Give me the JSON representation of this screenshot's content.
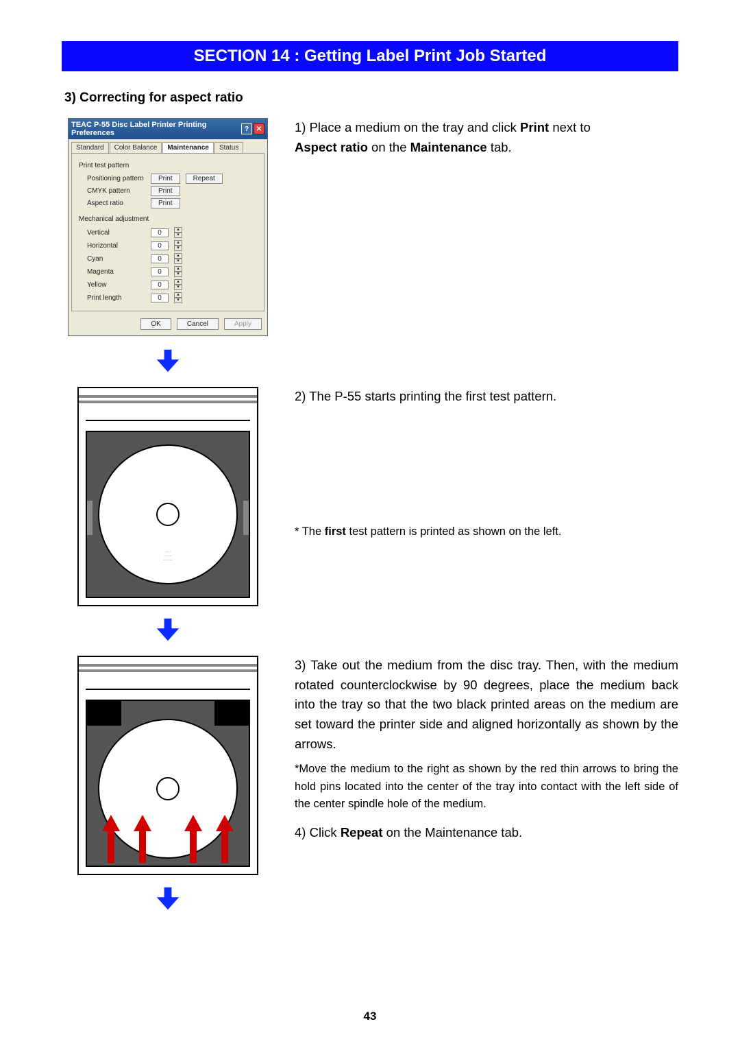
{
  "section_title": "SECTION 14 : Getting Label Print Job Started",
  "subheading": "3) Correcting for aspect ratio",
  "dialog": {
    "title": "TEAC P-55 Disc Label Printer Printing Preferences",
    "tabs": {
      "standard": "Standard",
      "color_balance": "Color Balance",
      "maintenance": "Maintenance",
      "status": "Status"
    },
    "group1": "Print test pattern",
    "positioning_label": "Positioning pattern",
    "print_btn": "Print",
    "repeat_btn": "Repeat",
    "cmyk_label": "CMYK pattern",
    "aspect_label": "Aspect ratio",
    "group2": "Mechanical adjustment",
    "adjust": {
      "vertical": "Vertical",
      "horizontal": "Horizontal",
      "cyan": "Cyan",
      "magenta": "Magenta",
      "yellow": "Yellow",
      "print_length": "Print length"
    },
    "val": "0",
    "ok": "OK",
    "cancel": "Cancel",
    "apply": "Apply"
  },
  "step1_a": "1) Place a medium on the tray and click ",
  "step1_b": "Print",
  "step1_c": " next to ",
  "step1_d": "Aspect ratio",
  "step1_e": " on the ",
  "step1_f": "Maintenance",
  "step1_g": " tab.",
  "step2": "2) The P-55 starts printing the first test pattern.",
  "note2_a": "* The ",
  "note2_b": "first",
  "note2_c": " test pattern is printed as shown on the left.",
  "step3": "3) Take out the medium from the disc tray. Then, with the medium rotated counterclockwise by 90 degrees, place the medium back into the tray so that the two black printed areas on the medium are set toward the printer side and aligned horizontally as shown by the arrows.",
  "note3": "*Move the medium to the right as shown by the red thin arrows to bring the hold pins located into the center of the tray into contact with the left side of the center spindle hole of the medium.",
  "step4_a": "4) Click ",
  "step4_b": "Repeat",
  "step4_c": " on the Maintenance tab.",
  "page_number": "43"
}
